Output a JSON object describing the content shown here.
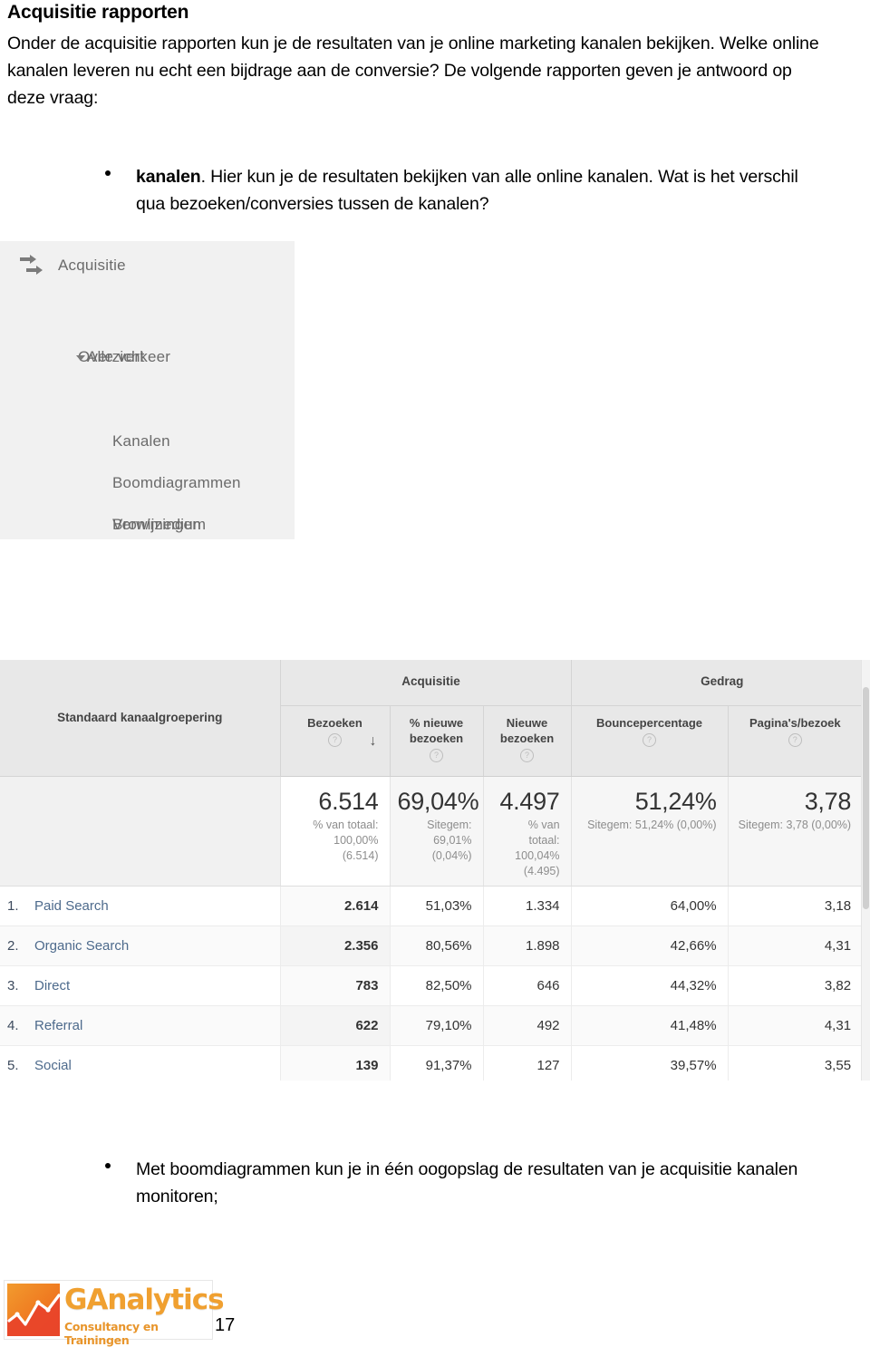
{
  "document": {
    "title": "Acquisitie rapporten",
    "intro_paragraph": "Onder de acquisitie rapporten kun je de resultaten van je online marketing kanalen bekijken. Welke online kanalen leveren nu echt een bijdrage aan de conversie? De volgende rapporten geven je antwoord op deze vraag:",
    "bullet_1_bold": "kanalen",
    "bullet_1_rest": ". Hier kun je de resultaten bekijken van alle online kanalen. Wat is het verschil qua bezoeken/conversies tussen de kanalen?",
    "bullet_2": "Met boomdiagrammen kun je in één oogopslag de resultaten van je acquisitie kanalen monitoren;",
    "page_number": "17"
  },
  "sidebar": {
    "header": {
      "label": "Acquisitie",
      "icon": "acquisition-arrows-icon"
    },
    "items": [
      {
        "label": "Overzicht",
        "level": 1,
        "expandable": false
      },
      {
        "label": "Alle verkeer",
        "level": 1,
        "expandable": true
      },
      {
        "label": "Kanalen",
        "level": 2,
        "expandable": false
      },
      {
        "label": "Boomdiagrammen",
        "level": 2,
        "expandable": false
      },
      {
        "label": "Bron/medium",
        "level": 2,
        "expandable": false
      },
      {
        "label": "Verwijzingen",
        "level": 2,
        "expandable": false
      }
    ]
  },
  "logo": {
    "word": "GAnalytics",
    "tagline": "Consultancy en Trainingen"
  },
  "chart_data": {
    "type": "table",
    "title": "Standaard kanaalgroepering",
    "group_headers": [
      {
        "label": "Acquisitie",
        "span": 3
      },
      {
        "label": "Gedrag",
        "span": 2
      }
    ],
    "dimension_header": "Standaard kanaalgroepering",
    "columns": [
      {
        "key": "bezoeken",
        "label": "Bezoeken",
        "help": "?",
        "sorted": true,
        "sort_direction": "descending"
      },
      {
        "key": "pct_nieuwe_bezoeken",
        "label": "% nieuwe bezoeken",
        "help": "?",
        "sorted": false
      },
      {
        "key": "nieuwe_bezoeken",
        "label": "Nieuwe bezoeken",
        "help": "?",
        "sorted": false
      },
      {
        "key": "bouncepercentage",
        "label": "Bouncepercentage",
        "help": "?",
        "sorted": false
      },
      {
        "key": "paginas_per_bezoek",
        "label": "Pagina's/bezoek",
        "help": "?",
        "sorted": false
      }
    ],
    "summary_row": [
      {
        "value": "6.514",
        "sub": [
          "% van totaal:",
          "100,00%",
          "(6.514)"
        ]
      },
      {
        "value": "69,04%",
        "sub": [
          "Sitegem:",
          "69,01%",
          "(0,04%)"
        ]
      },
      {
        "value": "4.497",
        "sub": [
          "% van",
          "totaal:",
          "100,04%",
          "(4.495)"
        ]
      },
      {
        "value": "51,24%",
        "sub": [
          "Sitegem: 51,24% (0,00%)"
        ]
      },
      {
        "value": "3,78",
        "sub": [
          "Sitegem: 3,78 (0,00%)"
        ]
      }
    ],
    "categories": [
      "Paid Search",
      "Organic Search",
      "Direct",
      "Referral",
      "Social"
    ],
    "rows": [
      {
        "index": "1.",
        "name": "Paid Search",
        "bezoeken": "2.614",
        "pct_nieuwe_bezoeken": "51,03%",
        "nieuwe_bezoeken": "1.334",
        "bouncepercentage": "64,00%",
        "paginas_per_bezoek": "3,18"
      },
      {
        "index": "2.",
        "name": "Organic Search",
        "bezoeken": "2.356",
        "pct_nieuwe_bezoeken": "80,56%",
        "nieuwe_bezoeken": "1.898",
        "bouncepercentage": "42,66%",
        "paginas_per_bezoek": "4,31"
      },
      {
        "index": "3.",
        "name": "Direct",
        "bezoeken": "783",
        "pct_nieuwe_bezoeken": "82,50%",
        "nieuwe_bezoeken": "646",
        "bouncepercentage": "44,32%",
        "paginas_per_bezoek": "3,82"
      },
      {
        "index": "4.",
        "name": "Referral",
        "bezoeken": "622",
        "pct_nieuwe_bezoeken": "79,10%",
        "nieuwe_bezoeken": "492",
        "bouncepercentage": "41,48%",
        "paginas_per_bezoek": "4,31"
      },
      {
        "index": "5.",
        "name": "Social",
        "bezoeken": "139",
        "pct_nieuwe_bezoeken": "91,37%",
        "nieuwe_bezoeken": "127",
        "bouncepercentage": "39,57%",
        "paginas_per_bezoek": "3,55"
      }
    ],
    "series": [
      {
        "name": "Bezoeken",
        "values": [
          2614,
          2356,
          783,
          622,
          139
        ]
      },
      {
        "name": "% nieuwe bezoeken",
        "values": [
          51.03,
          80.56,
          82.5,
          79.1,
          91.37
        ]
      },
      {
        "name": "Nieuwe bezoeken",
        "values": [
          1334,
          1898,
          646,
          492,
          127
        ]
      },
      {
        "name": "Bouncepercentage",
        "values": [
          64.0,
          42.66,
          44.32,
          41.48,
          39.57
        ]
      },
      {
        "name": "Pagina's/bezoek",
        "values": [
          3.18,
          4.31,
          3.82,
          4.31,
          3.55
        ]
      }
    ],
    "totals": {
      "bezoeken": 6514,
      "pct_nieuwe_bezoeken": 69.04,
      "nieuwe_bezoeken": 4497,
      "bouncepercentage": 51.24,
      "paginas_per_bezoek": 3.78
    }
  }
}
